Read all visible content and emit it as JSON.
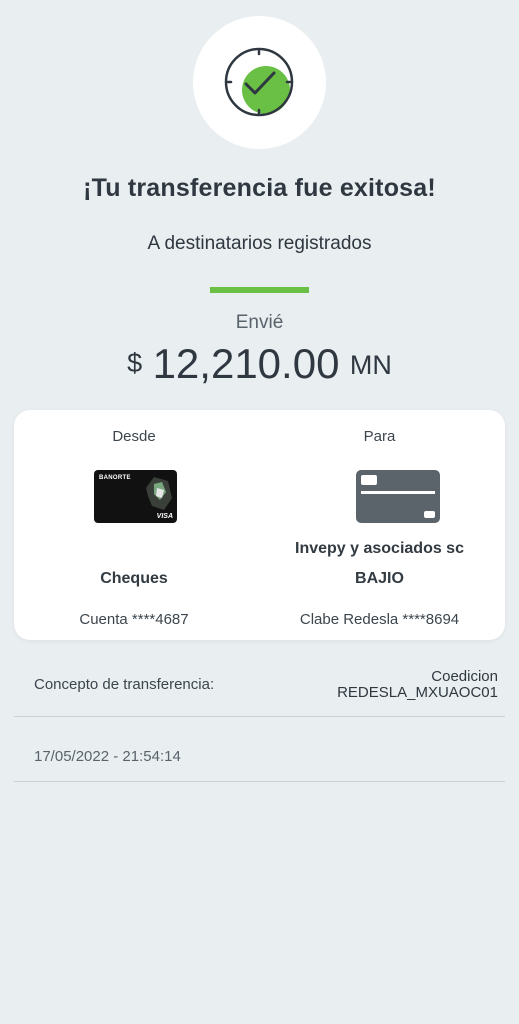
{
  "header": {
    "title": "¡Tu transferencia fue exitosa!",
    "subtitle": "A destinatarios registrados",
    "success_icon": "check-circle-icon",
    "accent_color": "#6abf45"
  },
  "amount": {
    "label": "Envié",
    "currency_symbol": "$",
    "value": "12,210.00",
    "unit": "MN"
  },
  "transfer": {
    "from": {
      "label": "Desde",
      "card_brand": "BANORTE",
      "card_network": "VISA",
      "account_type": "Cheques",
      "account_number": "Cuenta ****4687"
    },
    "to": {
      "label": "Para",
      "card_icon": "credit-card-icon",
      "recipient_name": "Invepy y asociados sc",
      "bank": "BAJIO",
      "account_number": "Clabe Redesla ****8694"
    }
  },
  "concept": {
    "label": "Concepto de transferencia:",
    "value_line1": "Coedicion",
    "value_line2": "REDESLA_MXUAOC01"
  },
  "timestamp": "17/05/2022 - 21:54:14"
}
